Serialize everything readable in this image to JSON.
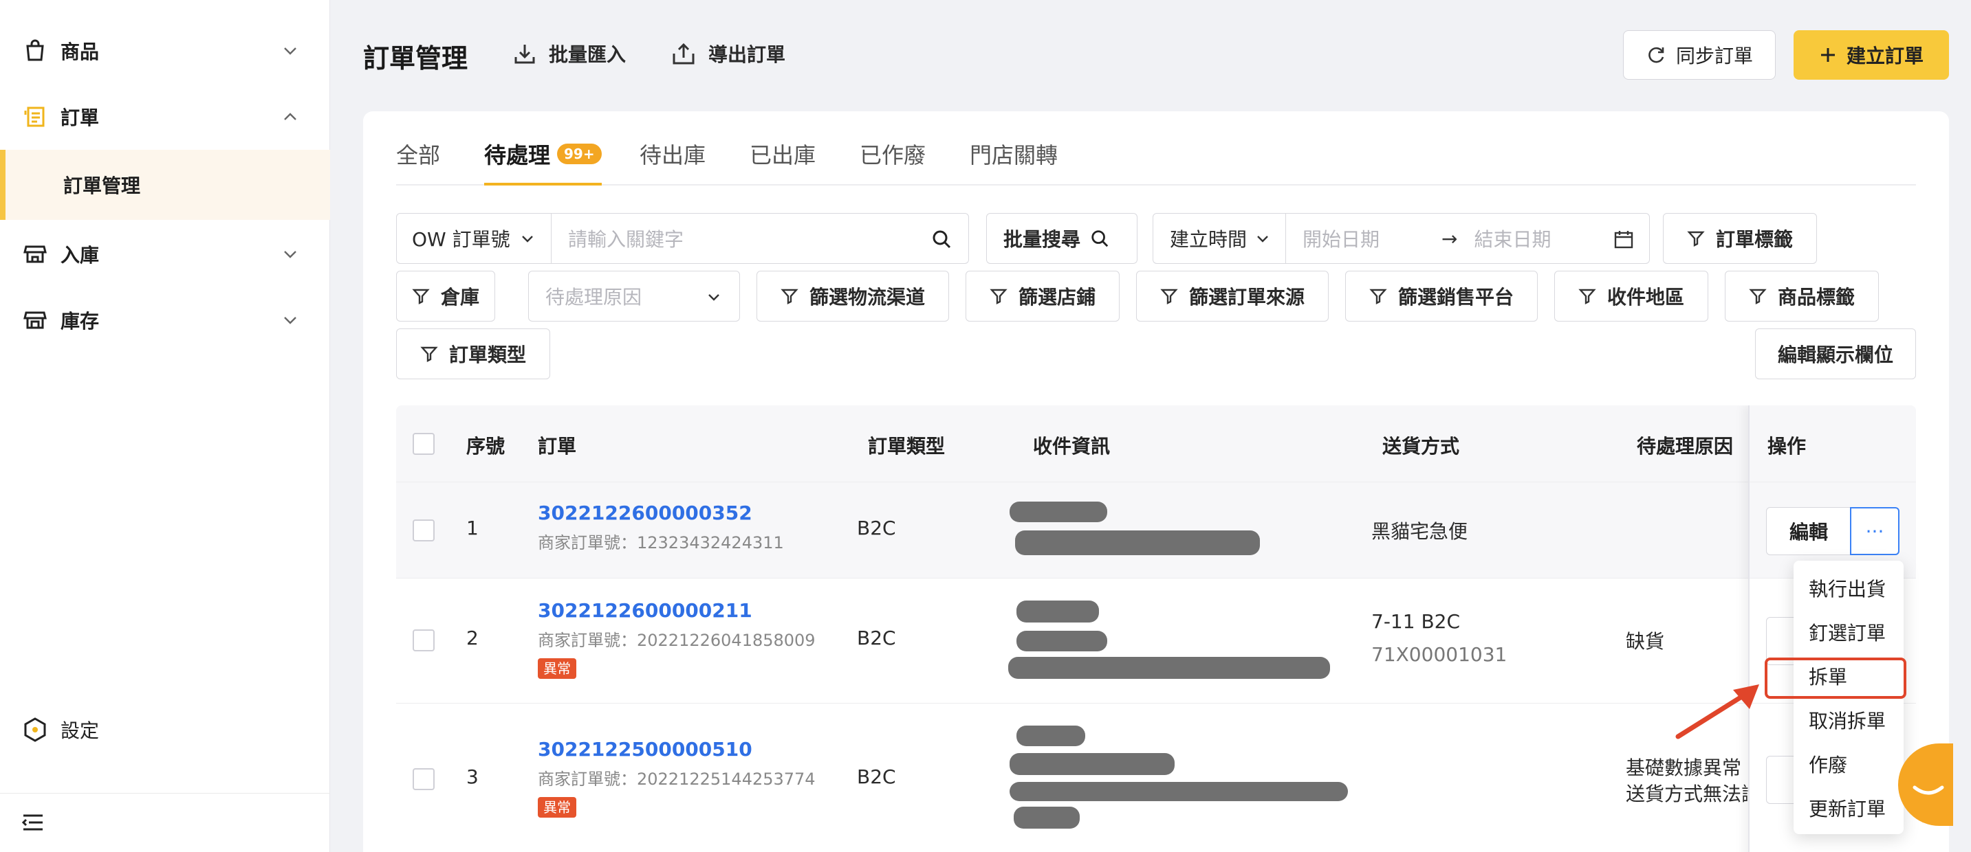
{
  "sidebar": {
    "items": [
      {
        "label": "商品",
        "icon": "bag-icon"
      },
      {
        "label": "訂單",
        "icon": "receipt-icon"
      },
      {
        "label": "入庫",
        "icon": "store-icon"
      },
      {
        "label": "庫存",
        "icon": "warehouse-icon"
      }
    ],
    "sub_item": "訂單管理",
    "settings": "設定"
  },
  "header": {
    "title": "訂單管理",
    "import": "批量匯入",
    "export": "導出訂單",
    "sync": "同步訂單",
    "create": "建立訂單"
  },
  "tabs": [
    {
      "label": "全部"
    },
    {
      "label": "待處理",
      "badge": "99+"
    },
    {
      "label": "待出庫"
    },
    {
      "label": "已出庫"
    },
    {
      "label": "已作廢"
    },
    {
      "label": "門店關轉"
    }
  ],
  "filters": {
    "search_type": "OW 訂單號",
    "search_placeholder": "請輸入關鍵字",
    "bulk_search": "批量搜尋",
    "time_type": "建立時間",
    "start_date": "開始日期",
    "end_date": "結束日期",
    "order_tag": "訂單標籤",
    "warehouse": "倉庫",
    "pending_reason_placeholder": "待處理原因",
    "logistics": "篩選物流渠道",
    "store": "篩選店鋪",
    "source": "篩選訂單來源",
    "platform": "篩選銷售平台",
    "region": "收件地區",
    "product_tag": "商品標籤",
    "order_type": "訂單類型",
    "edit_columns": "編輯顯示欄位"
  },
  "table": {
    "columns": [
      "序號",
      "訂單",
      "訂單類型",
      "收件資訊",
      "送貨方式",
      "待處理原因",
      "操作"
    ],
    "rows": [
      {
        "index": "1",
        "order_no": "3022122600000352",
        "merchant": "商家訂單號：12323432424311",
        "type": "B2C",
        "shipping": "黑貓宅急便",
        "shipping2": "",
        "reason": "",
        "reason2": "",
        "tag": ""
      },
      {
        "index": "2",
        "order_no": "3022122600000211",
        "merchant": "商家訂單號：20221226041858009",
        "type": "B2C",
        "shipping": "7-11 B2C",
        "shipping2": "71X00001031",
        "reason": "缺貨",
        "reason2": "",
        "tag": "異常"
      },
      {
        "index": "3",
        "order_no": "3022122500000510",
        "merchant": "商家訂單號：20221225144253774",
        "type": "B2C",
        "shipping": "",
        "shipping2": "",
        "reason": "基礎數據異常",
        "reason2": "送貨方式無法識",
        "tag": "異常"
      }
    ],
    "edit_label": "編輯",
    "more_label": "···"
  },
  "dropdown": [
    "執行出貨",
    "釘選訂單",
    "拆單",
    "取消拆單",
    "作廢",
    "更新訂單"
  ],
  "colors": {
    "accent": "#f8c93b",
    "link": "#2f6fe4",
    "error": "#e6542c",
    "highlight": "#e0452a"
  }
}
